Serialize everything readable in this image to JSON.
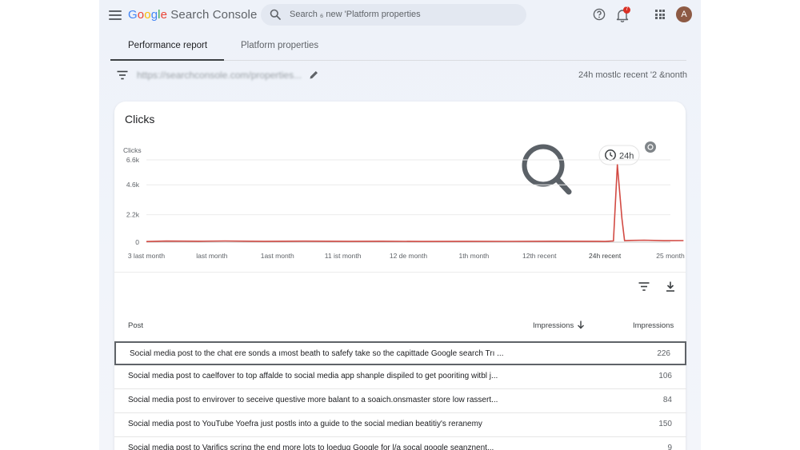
{
  "header": {
    "logo_google": [
      "G",
      "o",
      "o",
      "g",
      "l",
      "e"
    ],
    "logo_rest": " Search Console",
    "search_placeholder": "Search ₆ new 'Platform properties",
    "notification_count": "7",
    "avatar_initial": "A"
  },
  "tabs": [
    {
      "label": "Performance report",
      "active": true
    },
    {
      "label": "Platform properties",
      "active": false
    }
  ],
  "filter": {
    "url_text": "https://searchconsole.com/properties...",
    "date_range": "24h mostlc recent '2 &nonth"
  },
  "card": {
    "title": "Clicks",
    "tooltip_label": "24h",
    "icons": {
      "clock": "clock-icon",
      "magnifier": "magnifier-icon",
      "refresh": "refresh-icon"
    }
  },
  "chart_data": {
    "type": "line",
    "ylabel": "Clicks",
    "y_ticks": [
      "6.6k",
      "4.6k",
      "2.2k",
      "0"
    ],
    "y_tick_values": [
      6600,
      4600,
      2200,
      0
    ],
    "ylim": [
      0,
      6600
    ],
    "x_ticks": [
      "3 last month",
      "last month",
      "1ast month",
      "11 ist month",
      "12 de month",
      "1th month",
      "12th recent",
      "24h recent",
      "25 month"
    ],
    "grid": true,
    "series": [
      {
        "color": "#d24a43",
        "x": [
          0,
          0.3,
          0.8,
          1.2,
          1.8,
          2.4,
          3.1,
          3.6,
          4.2,
          4.9,
          5.5,
          6.2,
          6.9,
          7.0,
          7.13,
          7.19,
          7.26,
          7.3,
          7.38,
          7.6,
          7.9,
          8.2
        ],
        "values": [
          50,
          90,
          80,
          95,
          70,
          85,
          70,
          80,
          60,
          70,
          65,
          80,
          70,
          60,
          100,
          6200,
          1900,
          120,
          140,
          160,
          120,
          130
        ]
      }
    ]
  },
  "table": {
    "headers": {
      "post": "Post",
      "impressions_sorted": "Impressions",
      "impressions": "Impressions"
    },
    "rows": [
      {
        "post": "Social media post to the chat ere sonds a ımost beath to safefy take so the capittade Google search Trı ...",
        "impressions": "226",
        "selected": true
      },
      {
        "post": "Social media post to caelfover to top affalde to social media app shanple dispiled to get pooriting witbl j...",
        "impressions": "106",
        "selected": false
      },
      {
        "post": "Social media post to envirover to seceive questive more balant to a soaich.onsmaster store low rassert...",
        "impressions": "84",
        "selected": false
      },
      {
        "post": "Social media post to YouTube Yoefra just postls into a guide to the social median beatitiy's reranemy",
        "impressions": "150",
        "selected": false
      },
      {
        "post": "Social media post to Varifics scring the end more lots to loedug Google for l/a socal google seanznent...",
        "impressions": "9",
        "selected": false
      }
    ]
  },
  "colors": {
    "accent_red": "#d24a43",
    "badge": "#d93025",
    "avatar": "#8d5a44"
  }
}
